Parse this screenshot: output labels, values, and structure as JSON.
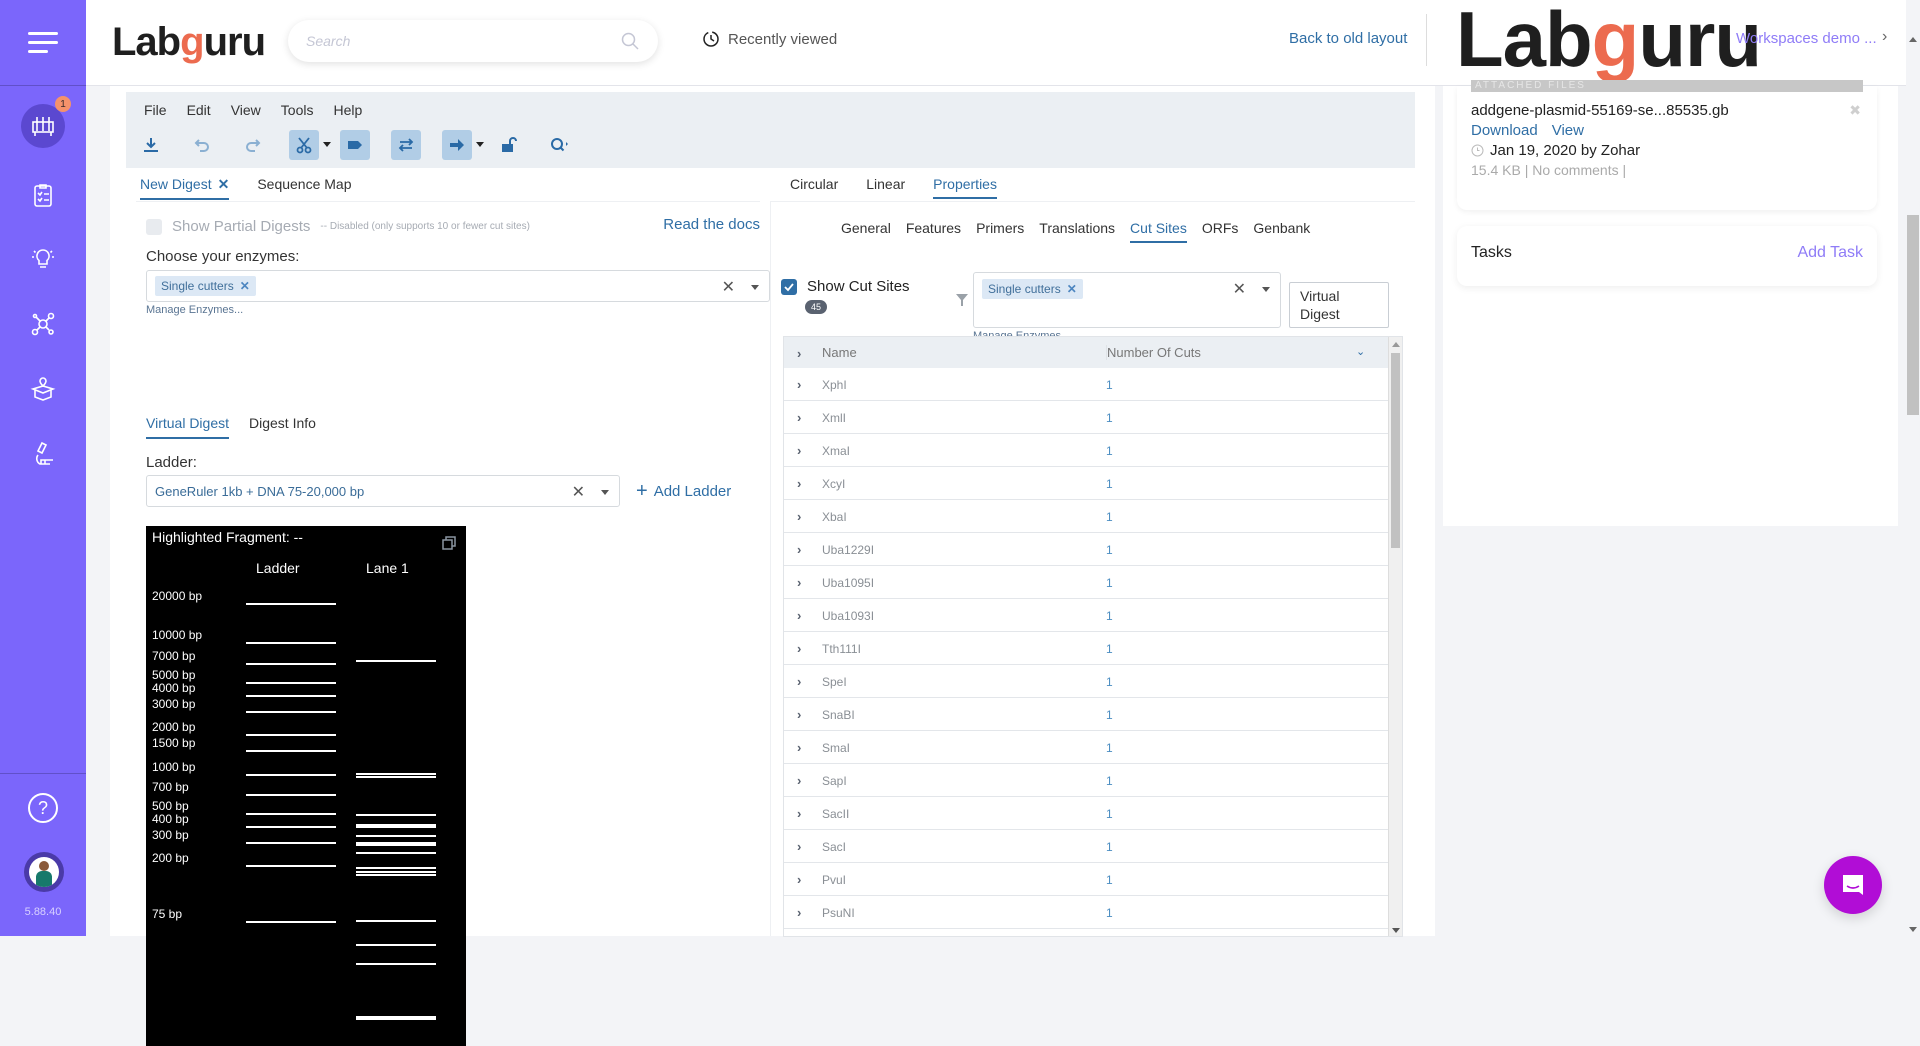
{
  "sidebar": {
    "items": [
      {
        "name": "inventory",
        "icon": "test-tubes-icon",
        "active": true,
        "badge": "1"
      },
      {
        "name": "protocols",
        "icon": "clipboard-checklist-icon"
      },
      {
        "name": "projects",
        "icon": "lightbulb-icon"
      },
      {
        "name": "network",
        "icon": "network-nodes-icon"
      },
      {
        "name": "storage",
        "icon": "box-location-icon"
      },
      {
        "name": "equipment",
        "icon": "microscope-icon"
      }
    ],
    "help_icon": "?",
    "version": "5.88.40"
  },
  "header": {
    "logo_prefix": "Lab",
    "logo_g": "g",
    "logo_suffix": "uru",
    "search_placeholder": "Search",
    "recently_viewed": "Recently viewed",
    "back_link": "Back to old layout",
    "workspace": "Workspaces demo ...",
    "workspace_chevron": "›"
  },
  "editor": {
    "menus": [
      "File",
      "Edit",
      "View",
      "Tools",
      "Help"
    ],
    "toolbar": [
      "download-icon",
      "undo-icon",
      "redo-icon",
      "cut-sites-icon",
      "features-icon",
      "orfs-icon",
      "direction-arrow-icon",
      "lock-icon",
      "find-icon"
    ],
    "left_tabs": [
      {
        "label": "New Digest",
        "active": true,
        "closable": "✕"
      },
      {
        "label": "Sequence Map",
        "active": false
      }
    ],
    "right_tabs": [
      {
        "label": "Circular",
        "active": false
      },
      {
        "label": "Linear",
        "active": false
      },
      {
        "label": "Properties",
        "active": true
      }
    ],
    "digest": {
      "partial_label": "Show Partial Digests",
      "partial_note": "-- Disabled (only supports 10 or fewer cut sites)",
      "read_docs": "Read the docs",
      "choose_label": "Choose your enzymes:",
      "enzyme_chip": "Single cutters",
      "manage_enzymes": "Manage Enzymes...",
      "subtabs": [
        {
          "label": "Virtual Digest",
          "active": true
        },
        {
          "label": "Digest Info",
          "active": false
        }
      ],
      "ladder_label": "Ladder:",
      "ladder_value": "GeneRuler 1kb + DNA 75-20,000 bp",
      "add_ladder": "Add Ladder",
      "gel": {
        "title": "Highlighted Fragment: --",
        "col_ladder": "Ladder",
        "col_lane": "Lane 1",
        "ladder_bands": [
          {
            "label": "20000 bp",
            "bp": 20000
          },
          {
            "label": "10000 bp",
            "bp": 10000
          },
          {
            "label": "7000 bp",
            "bp": 7000
          },
          {
            "label": "5000 bp",
            "bp": 5000
          },
          {
            "label": "4000 bp",
            "bp": 4000
          },
          {
            "label": "3000 bp",
            "bp": 3000
          },
          {
            "label": "2000 bp",
            "bp": 2000
          },
          {
            "label": "1500 bp",
            "bp": 1500
          },
          {
            "label": "1000 bp",
            "bp": 1000
          },
          {
            "label": "700 bp",
            "bp": 700
          },
          {
            "label": "500 bp",
            "bp": 500
          },
          {
            "label": "400 bp",
            "bp": 400
          },
          {
            "label": "300 bp",
            "bp": 300
          },
          {
            "label": "200 bp",
            "bp": 200
          },
          {
            "label": "75 bp",
            "bp": 75
          }
        ],
        "lane1_bands_bp": [
          7400,
          1010,
          950,
          490,
          410,
          400,
          340,
          300,
          290,
          250,
          195,
          180,
          172,
          76,
          60,
          48,
          14,
          13
        ]
      }
    },
    "properties": {
      "tabs": [
        {
          "label": "General",
          "active": false
        },
        {
          "label": "Features",
          "active": false
        },
        {
          "label": "Primers",
          "active": false
        },
        {
          "label": "Translations",
          "active": false
        },
        {
          "label": "Cut Sites",
          "active": true
        },
        {
          "label": "ORFs",
          "active": false
        },
        {
          "label": "Genbank",
          "active": false
        }
      ],
      "show_cut_sites": "Show Cut Sites",
      "cut_count": "45",
      "filter_chip": "Single cutters",
      "manage_enzymes": "Manage Enzymes...",
      "virtual_digest_btn": "Virtual Digest",
      "columns": [
        "Name",
        "Number Of Cuts"
      ],
      "rows": [
        {
          "name": "XphI",
          "cuts": "1"
        },
        {
          "name": "XmlI",
          "cuts": "1"
        },
        {
          "name": "XmaI",
          "cuts": "1"
        },
        {
          "name": "XcyI",
          "cuts": "1"
        },
        {
          "name": "XbaI",
          "cuts": "1"
        },
        {
          "name": "Uba1229I",
          "cuts": "1"
        },
        {
          "name": "Uba1095I",
          "cuts": "1"
        },
        {
          "name": "Uba1093I",
          "cuts": "1"
        },
        {
          "name": "Tth111I",
          "cuts": "1"
        },
        {
          "name": "SpeI",
          "cuts": "1"
        },
        {
          "name": "SnaBI",
          "cuts": "1"
        },
        {
          "name": "SmaI",
          "cuts": "1"
        },
        {
          "name": "SapI",
          "cuts": "1"
        },
        {
          "name": "SacII",
          "cuts": "1"
        },
        {
          "name": "SacI",
          "cuts": "1"
        },
        {
          "name": "PvuI",
          "cuts": "1"
        },
        {
          "name": "PsuNI",
          "cuts": "1"
        }
      ]
    }
  },
  "attachments": {
    "header": "ATTACHED FILES",
    "file_name": "addgene-plasmid-55169-se...85535.gb",
    "download": "Download",
    "view": "View",
    "date": "Jan 19, 2020 by Zohar",
    "meta": "15.4 KB | No comments |"
  },
  "tasks": {
    "title": "Tasks",
    "add": "Add Task"
  },
  "colors": {
    "sidebar": "#7b66fb",
    "accent_blue": "#2f6ea5",
    "accent_purple": "#8f7cf7",
    "chat": "#b10dd6"
  }
}
